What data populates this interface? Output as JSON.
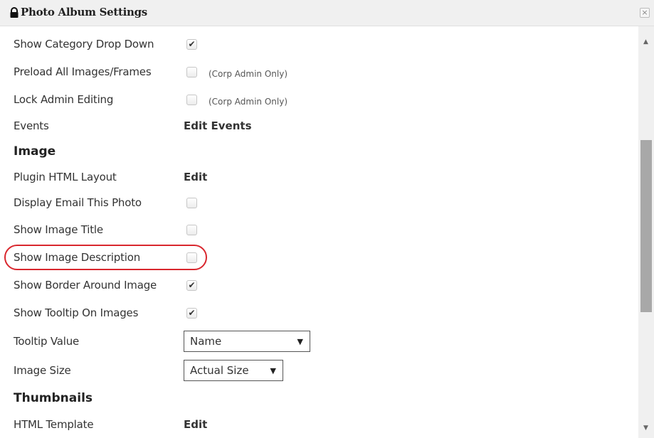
{
  "window": {
    "title": "Photo Album Settings",
    "close_glyph": "×"
  },
  "rows": {
    "show_category_drop_down": {
      "label": "Show Category Drop Down",
      "checked": true
    },
    "preload_all_images": {
      "label": "Preload All Images/Frames",
      "checked": false,
      "note": "(Corp Admin Only)"
    },
    "lock_admin_editing": {
      "label": "Lock Admin Editing",
      "checked": false,
      "note": "(Corp Admin Only)"
    },
    "events": {
      "label": "Events",
      "link": "Edit Events"
    }
  },
  "image_section": {
    "heading": "Image",
    "plugin_html_layout": {
      "label": "Plugin HTML Layout",
      "link": "Edit"
    },
    "display_email_this_photo": {
      "label": "Display Email This Photo",
      "checked": false
    },
    "show_image_title": {
      "label": "Show Image Title",
      "checked": false
    },
    "show_image_description": {
      "label": "Show Image Description",
      "checked": false
    },
    "show_border_around_image": {
      "label": "Show Border Around Image",
      "checked": true
    },
    "show_tooltip_on_images": {
      "label": "Show Tooltip On Images",
      "checked": true
    },
    "tooltip_value": {
      "label": "Tooltip Value",
      "selected": "Name"
    },
    "image_size": {
      "label": "Image Size",
      "selected": "Actual Size"
    }
  },
  "thumbnails_section": {
    "heading": "Thumbnails",
    "html_template": {
      "label": "HTML Template",
      "link": "Edit"
    }
  },
  "glyphs": {
    "check": "✔",
    "dropdown_arrow": "▼",
    "scroll_up": "▲",
    "scroll_down": "▼"
  },
  "colors": {
    "highlight": "#d9272e",
    "titlebar_bg": "#f0f0f0",
    "scroll_thumb": "#a8a8a8"
  }
}
